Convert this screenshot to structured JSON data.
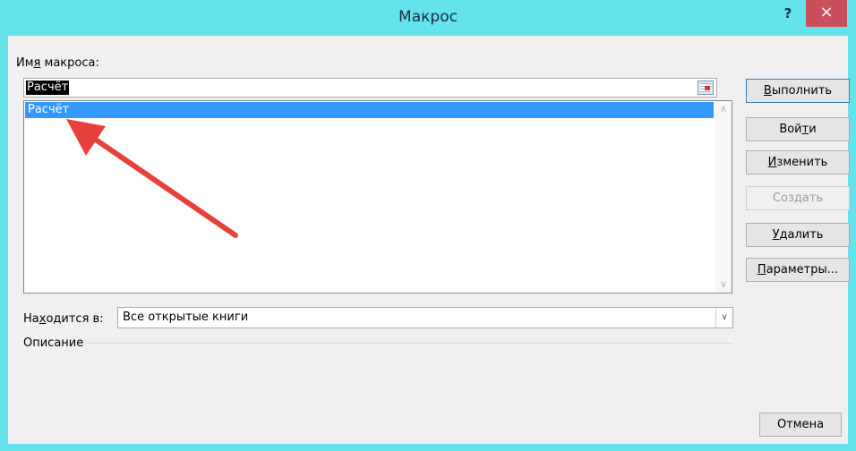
{
  "window": {
    "title": "Макрос",
    "help_label": "?",
    "close_label": "×"
  },
  "macro_name": {
    "label_pre": "Им",
    "label_ul": "я",
    "label_post": " макроса:",
    "value": "Расчёт"
  },
  "macro_list": {
    "items": [
      "Расчёт"
    ],
    "selected": "Расчёт"
  },
  "buttons": {
    "run": {
      "pre": "",
      "ul": "В",
      "post": "ыполнить"
    },
    "step_into": {
      "pre": "Вой",
      "ul": "т",
      "post": "и"
    },
    "edit": {
      "pre": "",
      "ul": "И",
      "post": "зменить"
    },
    "create": {
      "pre": "",
      "ul": "",
      "post": "Создать"
    },
    "delete": {
      "pre": "",
      "ul": "У",
      "post": "далить"
    },
    "options": {
      "pre": "",
      "ul": "П",
      "post": "араметры..."
    },
    "cancel": "Отмена"
  },
  "location": {
    "label_pre": "На",
    "label_ul": "х",
    "label_post": "одится в:",
    "value": "Все открытые книги"
  },
  "description": {
    "label": "Описание"
  },
  "colors": {
    "titlebar": "#65e3ec",
    "close": "#c9505a",
    "selection": "#3399ff",
    "annotation_arrow": "#e8413c"
  },
  "icons": {
    "ref_picker": "range-select-icon",
    "list_scroll_up": "chevron-up-icon",
    "list_scroll_down": "chevron-down-icon",
    "combo_drop": "chevron-down-icon"
  }
}
